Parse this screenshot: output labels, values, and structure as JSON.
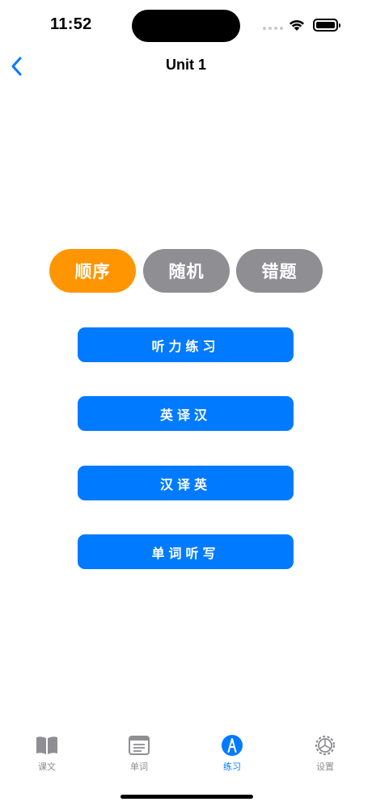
{
  "status_bar": {
    "time": "11:52"
  },
  "nav": {
    "title": "Unit 1"
  },
  "modes": [
    {
      "label": "顺序",
      "selected": true
    },
    {
      "label": "随机",
      "selected": false
    },
    {
      "label": "错题",
      "selected": false
    }
  ],
  "practice_buttons": [
    {
      "label": "听力练习"
    },
    {
      "label": "英译汉"
    },
    {
      "label": "汉译英"
    },
    {
      "label": "单词听写"
    }
  ],
  "tabs": [
    {
      "label": "课文",
      "icon": "book-icon",
      "active": false
    },
    {
      "label": "单词",
      "icon": "list-icon",
      "active": false
    },
    {
      "label": "练习",
      "icon": "pencil-circle-icon",
      "active": true
    },
    {
      "label": "设置",
      "icon": "gear-icon",
      "active": false
    }
  ],
  "colors": {
    "accent": "#007aff",
    "selected_mode": "#ff9500",
    "inactive": "#8e8e93"
  }
}
